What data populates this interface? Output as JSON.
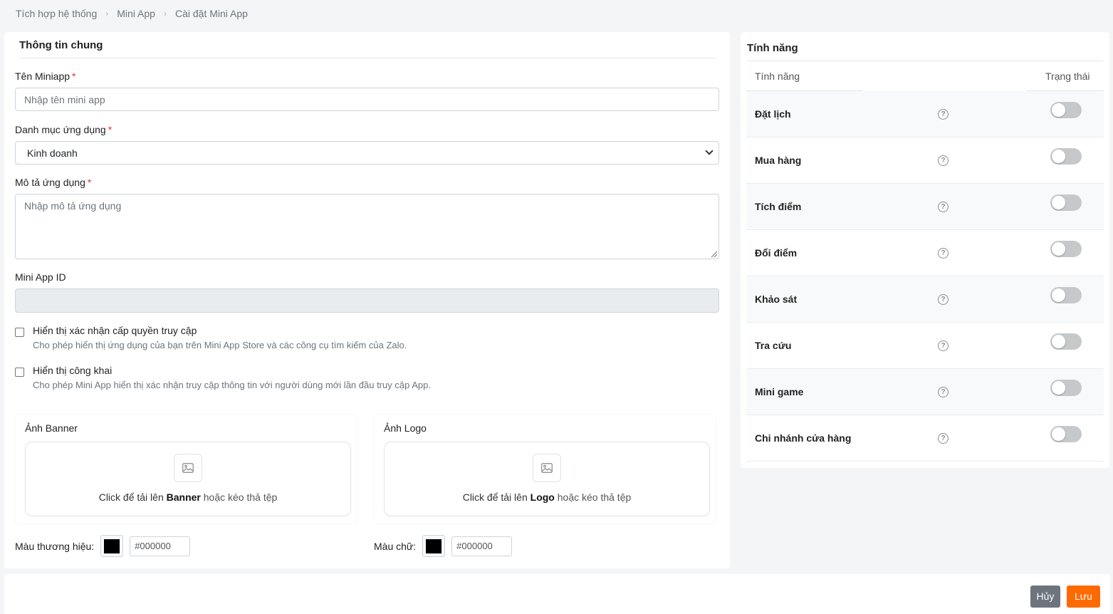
{
  "breadcrumb": [
    "Tích hợp hệ thống",
    "Mini App",
    "Cài đặt Mini App"
  ],
  "general": {
    "title": "Thông tin chung",
    "name_label": "Tên Miniapp",
    "name_placeholder": "Nhập tên mini app",
    "category_label": "Danh mục ứng dụng",
    "category_value": "Kinh doanh",
    "description_label": "Mô tả ứng dụng",
    "description_placeholder": "Nhập mô tả ứng dụng",
    "appid_label": "Mini App ID",
    "appid_value": "",
    "required_mark": "*"
  },
  "options": [
    {
      "title": "Hiển thị xác nhận cấp quyền truy cập",
      "desc": "Cho phép hiển thị ứng dụng của bạn trên Mini App Store và các công cụ tìm kiếm của Zalo.",
      "checked": false
    },
    {
      "title": "Hiển thị công khai",
      "desc": "Cho phép Mini App hiển thị xác nhận truy cập thông tin với người dùng mới lần đầu truy cập App.",
      "checked": false
    }
  ],
  "uploads": {
    "banner": {
      "label": "Ảnh Banner",
      "prefix": "Click để tải lên",
      "target": "Banner",
      "suffix": "hoặc kéo thả tệp",
      "icon": "image-icon"
    },
    "logo": {
      "label": "Ảnh Logo",
      "prefix": "Click để tải lên",
      "target": "Logo",
      "suffix": "hoặc kéo thả tệp",
      "icon": "image-icon"
    }
  },
  "colors": {
    "brand_label": "Màu thương hiệu:",
    "brand_value": "#000000",
    "text_label": "Màu chữ:",
    "text_value": "#000000"
  },
  "features": {
    "title": "Tính năng",
    "col_feature": "Tính năng",
    "col_status": "Trạng thái",
    "items": [
      {
        "name": "Đặt lịch",
        "enabled": false
      },
      {
        "name": "Mua hàng",
        "enabled": false
      },
      {
        "name": "Tích điểm",
        "enabled": false
      },
      {
        "name": "Đổi điểm",
        "enabled": false
      },
      {
        "name": "Khảo sát",
        "enabled": false
      },
      {
        "name": "Tra cứu",
        "enabled": false
      },
      {
        "name": "Mini game",
        "enabled": false
      },
      {
        "name": "Chi nhánh cửa hàng",
        "enabled": false
      }
    ],
    "help_glyph": "?"
  },
  "actions": {
    "cancel": "Hủy",
    "save": "Lưu"
  },
  "theme": {
    "accent": "#ff6a00",
    "secondary": "#6c757d",
    "required": "#e03131"
  }
}
